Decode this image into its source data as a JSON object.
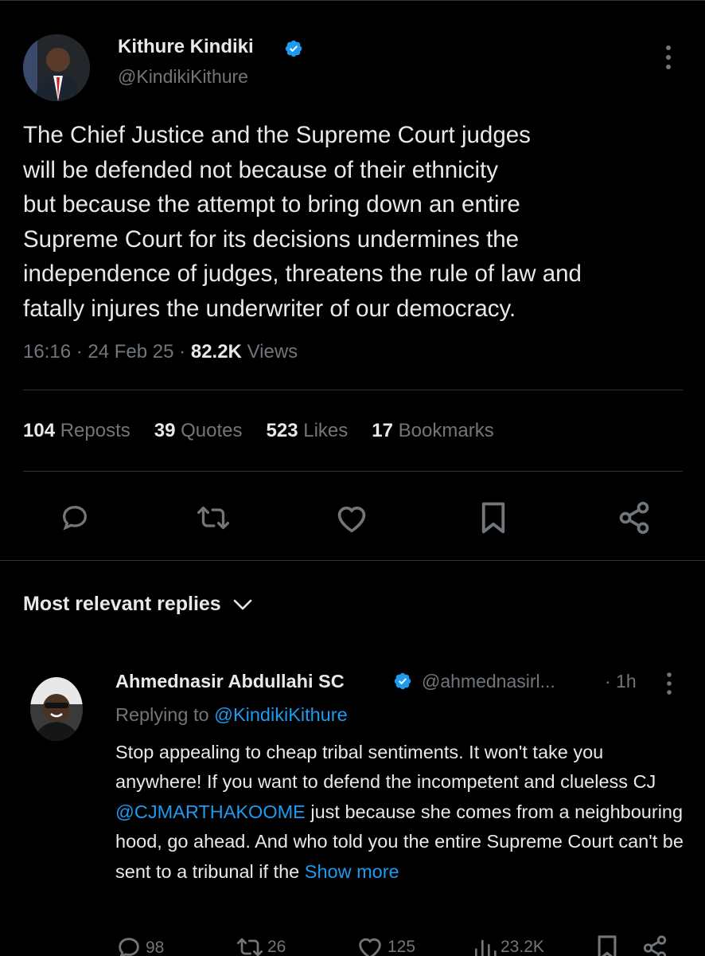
{
  "tweet": {
    "author_name": "Kithure Kindiki",
    "author_handle": "@KindikiKithure",
    "text": "The Chief Justice and the Supreme Court judges\nwill be defended not because of their ethnicity\nbut because the  attempt to bring down an entire\nSupreme Court for its decisions undermines the\nindependence of judges, threatens the rule of law and\nfatally injures the underwriter of our democracy.",
    "time": "16:16",
    "date": "24 Feb 25",
    "views_count": "82.2K",
    "views_label": "Views"
  },
  "stats": {
    "reposts": {
      "count": "104",
      "label": "Reposts"
    },
    "quotes": {
      "count": "39",
      "label": "Quotes"
    },
    "likes": {
      "count": "523",
      "label": "Likes"
    },
    "bookmarks": {
      "count": "17",
      "label": "Bookmarks"
    }
  },
  "actions": {
    "icons": [
      "reply-icon",
      "repost-icon",
      "like-icon",
      "bookmark-icon",
      "share-icon"
    ]
  },
  "replies_section": {
    "heading": "Most relevant replies"
  },
  "reply": {
    "author_name": "Ahmednasir Abdullahi SC",
    "author_handle": "@ahmednasirl...",
    "time": "· 1h",
    "replying_prefix": "Replying to",
    "replying_to": "@KindikiKithure",
    "text_part1": "Stop appealing to cheap tribal sentiments. It won't take you anywhere! If you want to defend the incompetent and clueless CJ ",
    "mention": "@CJMARTHAKOOME",
    "text_part2": " just because she comes from a neighbouring hood, go ahead. And who told you the entire Supreme Court can't be sent to a tribunal if the ",
    "show_more": "Show more",
    "counts": {
      "replies": "98",
      "reposts": "26",
      "likes": "125",
      "views": "23.2K"
    }
  },
  "colors": {
    "background": "#000000",
    "text_primary": "#e7e9ea",
    "text_secondary": "#71767b",
    "link": "#1d9bf0",
    "divider": "#2f3336",
    "verified": "#1d9bf0"
  }
}
